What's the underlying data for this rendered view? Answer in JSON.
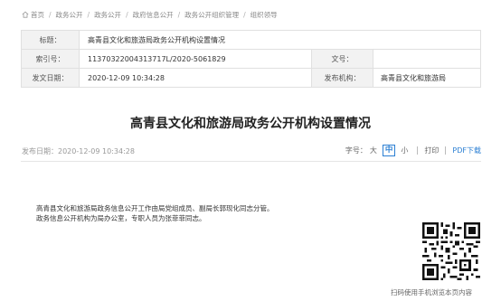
{
  "breadcrumb": [
    "首页",
    "政务公开",
    "政务公开",
    "政府信息公开",
    "政务公开组织管理",
    "组织领导"
  ],
  "meta": {
    "title_label": "标题：",
    "title_value": "高青县文化和旅游局政务公开机构设置情况",
    "index_label": "索引号：",
    "index_value": "11370322004313717L/2020-5061829",
    "docno_label": "文号：",
    "docno_value": "",
    "date_label": "发文日期：",
    "date_value": "2020-12-09 10:34:28",
    "issuer_label": "发布机构：",
    "issuer_value": "高青县文化和旅游局"
  },
  "article": {
    "title": "高青县文化和旅游局政务公开机构设置情况",
    "publish_time": "发布日期：2020-12-09 10:34:28",
    "paragraphs": [
      "高青县文化和旅游局政务信息公开工作由局党组成员、副局长郭现化同志分管。",
      "政务信息公开机构为局办公室，专职人员为张菲菲同志。"
    ]
  },
  "tools": {
    "fontsize_label": "字号：",
    "large": "大",
    "medium": "中",
    "small": "小",
    "print": "打印",
    "pdf": "PDF下载"
  },
  "qr_caption": "扫码使用手机浏览本页内容"
}
